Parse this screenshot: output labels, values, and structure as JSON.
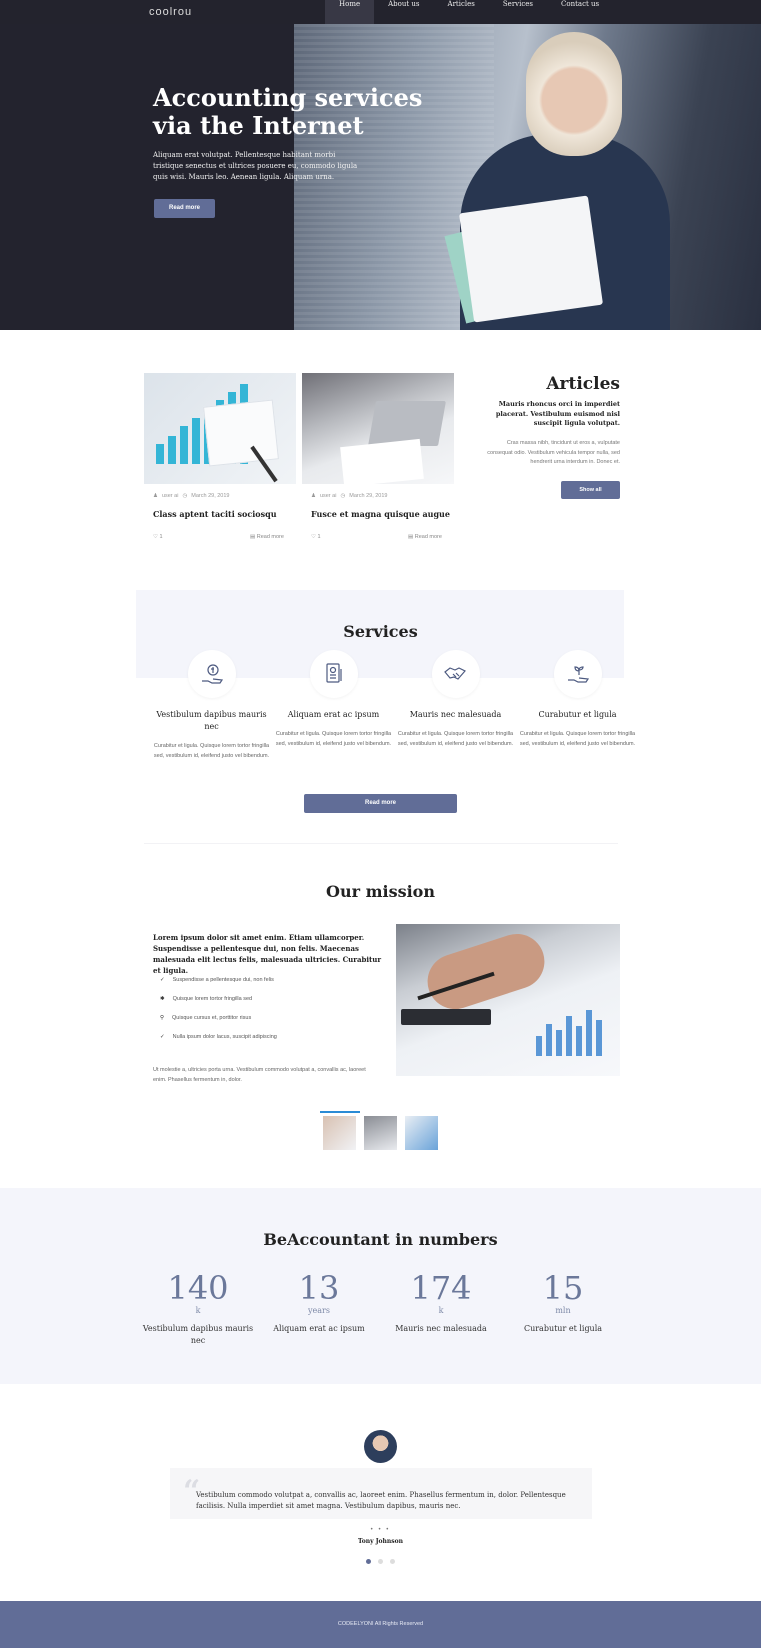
{
  "nav": {
    "logo": "coolrou",
    "links": [
      "Home",
      "About us",
      "Articles",
      "Services",
      "Contact us"
    ]
  },
  "hero": {
    "title": "Accounting services via the Internet",
    "text": "Aliquam erat volutpat. Pellentesque habitant morbi tristique senectus et ultrices posuere eu, commodo ligula quis wisi. Mauris leo. Aenean ligula. Aliquam urna.",
    "button": "Read more"
  },
  "articles": {
    "title": "Articles",
    "subtitle": "Mauris rhoncus orci in imperdiet placerat. Vestibulum euismod nisl suscipit ligula volutpat.",
    "text": "Cras massa nibh, tincidunt ut eros a, vulputate consequat odio. Vestibulum vehicula tempor nulla, sed hendrerit urna interdum in. Donec et.",
    "button": "Show all",
    "cards": [
      {
        "author": "user ai",
        "date": "March 29, 2019",
        "title": "Class aptent taciti sociosqu",
        "likes": "1",
        "read": "Read more"
      },
      {
        "author": "user ai",
        "date": "March 29, 2019",
        "title": "Fusce et magna quisque augue",
        "likes": "1",
        "read": "Read more"
      }
    ]
  },
  "services": {
    "title": "Services",
    "items": [
      {
        "title": "Vestibulum dapibus mauris nec",
        "text": "Curabitur et ligula. Quisque lorem tortor fringilla sed, vestibulum id, eleifend justo vel bibendum."
      },
      {
        "title": "Aliquam erat ac ipsum",
        "text": "Curabitur et ligula. Quisque lorem tortor fringilla sed, vestibulum id, eleifend justo vel bibendum."
      },
      {
        "title": "Mauris nec malesuada",
        "text": "Curabitur et ligula. Quisque lorem tortor fringilla sed, vestibulum id, eleifend justo vel bibendum."
      },
      {
        "title": "Curabutur et ligula",
        "text": "Curabitur et ligula. Quisque lorem tortor fringilla sed, vestibulum id, eleifend justo vel bibendum."
      }
    ],
    "button": "Read more"
  },
  "mission": {
    "title": "Our mission",
    "lead": "Lorem ipsum dolor sit amet enim. Etiam ullamcorper. Suspendisse a pellentesque dui, non felis. Maecenas malesuada elit lectus felis, malesuada ultricies. Curabitur et ligula.",
    "list": [
      "Suspendisse a pellentesque dui, non felis",
      "Quisque lorem tortor fringilla sed",
      "Quisque cursus et, porttitor risus",
      "Nulla ipsum dolor lacus, suscipit adipiscing"
    ],
    "footer": "Ut molestie a, ultricies porta urna. Vestibulum commodo volutpat a, convallis ac, laoreet enim. Phasellus fermentum in, dolor."
  },
  "numbers": {
    "title": "BeAccountant in numbers",
    "items": [
      {
        "value": "140",
        "unit": "k",
        "label": "Vestibulum dapibus mauris nec"
      },
      {
        "value": "13",
        "unit": "years",
        "label": "Aliquam erat ac ipsum"
      },
      {
        "value": "174",
        "unit": "k",
        "label": "Mauris nec malesuada"
      },
      {
        "value": "15",
        "unit": "mln",
        "label": "Curabutur et ligula"
      }
    ]
  },
  "testimonial": {
    "text": "Vestibulum commodo volutpat a, convallis ac, laoreet enim. Phasellus fermentum in, dolor. Pellentesque facilisis. Nulla imperdiet sit amet magna. Vestibulum dapibus, mauris nec.",
    "dots": "• • •",
    "author": "Tony Johnson"
  },
  "footer": {
    "text": "CODEELYONI All Rights Reserved"
  },
  "colors": {
    "accent": "#616d97",
    "dark": "#23232d",
    "light_bg": "#f4f5fb"
  }
}
